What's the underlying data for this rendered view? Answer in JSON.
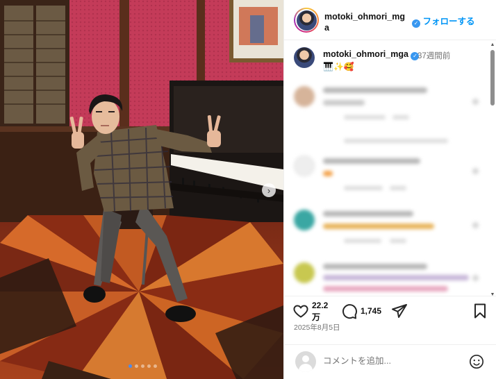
{
  "post": {
    "username": "motoki_ohmori_mga",
    "follow_label": "フォローする",
    "more_label": "···",
    "caption_user": "motoki_ohmori_mga",
    "time_ago": "37週間前",
    "caption_text": "🎹✨🥰",
    "likes_line1": "22.2",
    "likes_line2": "万",
    "comments_count": "1,745",
    "date": "2025年8月5日",
    "add_comment_placeholder": "コメントを追加..."
  },
  "carousel": {
    "count": 5,
    "active_index": 0,
    "next_label": "›"
  },
  "colors": {
    "accent": "#0095f6",
    "verified": "#3897f0",
    "active_dot": "#4a8cf0"
  },
  "icons": [
    "verified-icon",
    "more-icon",
    "heart-icon",
    "comment-icon",
    "share-icon",
    "bookmark-icon",
    "emoji-icon",
    "next-arrow-icon"
  ]
}
